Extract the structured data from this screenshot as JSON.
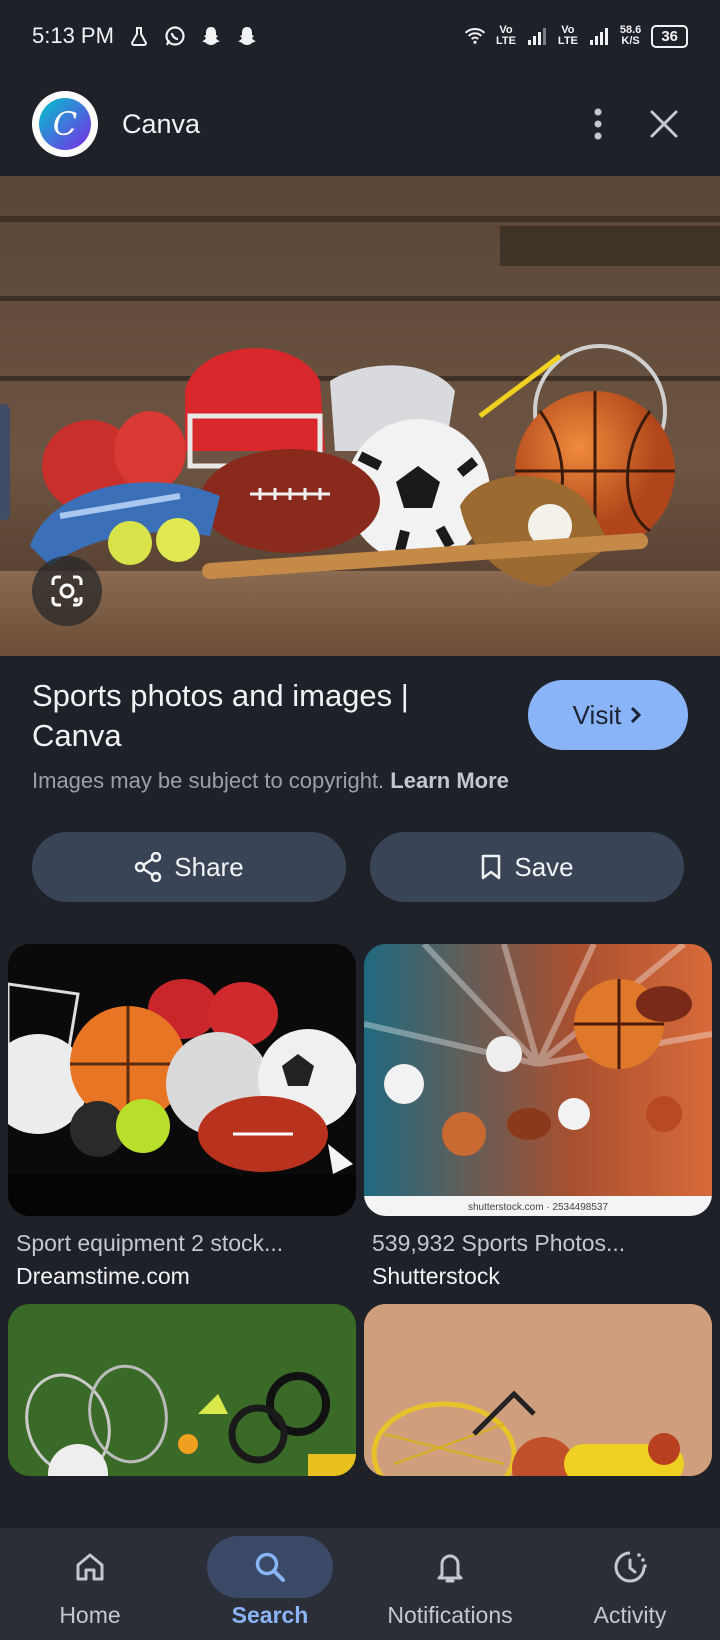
{
  "status_bar": {
    "time": "5:13 PM",
    "net_line1": "Vo",
    "net_line2": "LTE",
    "net2_line1": "Vo",
    "net2_line2": "LTE",
    "speed_line1": "58.6",
    "speed_line2": "K/S",
    "battery": "36"
  },
  "app_bar": {
    "title": "Canva",
    "logo_letter": "C"
  },
  "result": {
    "title": "Sports photos and images | Canva",
    "visit_label": "Visit",
    "copyright_text": "Images may be subject to copyright.",
    "learn_more": "Learn More",
    "share_label": "Share",
    "save_label": "Save"
  },
  "related": [
    {
      "title": "Sport equipment 2 stock...",
      "source": "Dreamstime.com"
    },
    {
      "title": "539,932 Sports Photos...",
      "source": "Shutterstock",
      "watermark": "shutterstock.com · 2534498537"
    },
    {
      "title": "",
      "source": ""
    },
    {
      "title": "",
      "source": ""
    }
  ],
  "bottom_nav": [
    {
      "label": "Home",
      "icon": "home-icon",
      "active": false
    },
    {
      "label": "Search",
      "icon": "search-icon",
      "active": true
    },
    {
      "label": "Notifications",
      "icon": "bell-icon",
      "active": false
    },
    {
      "label": "Activity",
      "icon": "activity-icon",
      "active": false
    }
  ],
  "colors": {
    "background": "#1f2128",
    "accent": "#8ab4f8",
    "button": "#394457"
  }
}
